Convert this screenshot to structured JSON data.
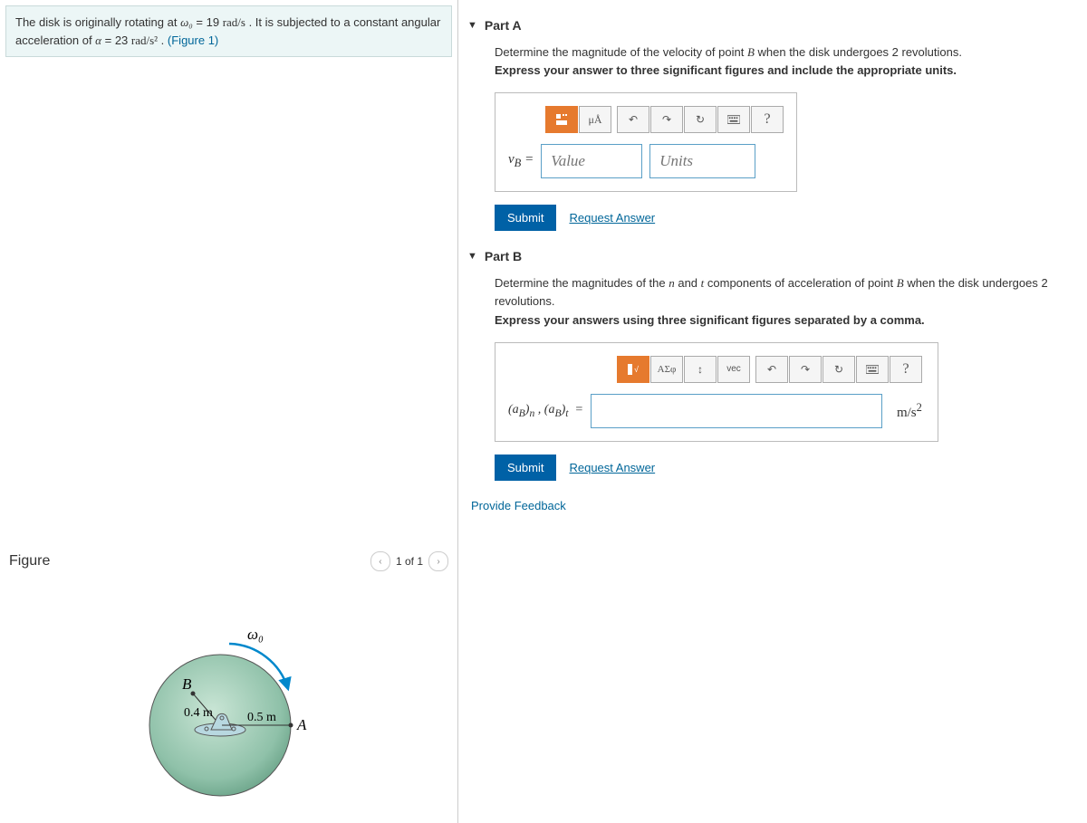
{
  "problem": {
    "text_pre": "The disk is originally rotating at ",
    "omega_var": "ω₀",
    "omega_eq": " = 19 ",
    "omega_unit": "rad/s",
    "text_mid": " . It is subjected to a constant angular acceleration of ",
    "alpha_var": "α",
    "alpha_eq": " = 23 ",
    "alpha_unit": "rad/s²",
    "text_post": " . ",
    "figure_link": "(Figure 1)"
  },
  "figure": {
    "title": "Figure",
    "nav_text": "1 of 1",
    "omega_label": "ω₀",
    "point_b": "B",
    "radius_b": "0.4 m",
    "radius_a": "0.5 m",
    "point_a": "A"
  },
  "partA": {
    "title": "Part A",
    "question_pre": "Determine the magnitude of the velocity of point ",
    "question_var": "B",
    "question_post": " when the disk undergoes 2 revolutions.",
    "instruction": "Express your answer to three significant figures and include the appropriate units.",
    "label": "v_B =",
    "value_placeholder": "Value",
    "units_placeholder": "Units",
    "tool_mu": "μÅ",
    "submit": "Submit",
    "request": "Request Answer"
  },
  "partB": {
    "title": "Part B",
    "question_pre": "Determine the magnitudes of the ",
    "question_n": "n",
    "question_and": " and ",
    "question_t": "t",
    "question_mid": " components of acceleration of point ",
    "question_var": "B",
    "question_post": " when the disk undergoes 2 revolutions.",
    "instruction": "Express your answers using three significant figures separated by a comma.",
    "label": "(a_B)_n , (a_B)_t  =",
    "unit_suffix": "m/s²",
    "tool_asigma": "ΑΣφ",
    "tool_vec": "vec",
    "submit": "Submit",
    "request": "Request Answer"
  },
  "feedback": "Provide Feedback",
  "help": "?"
}
